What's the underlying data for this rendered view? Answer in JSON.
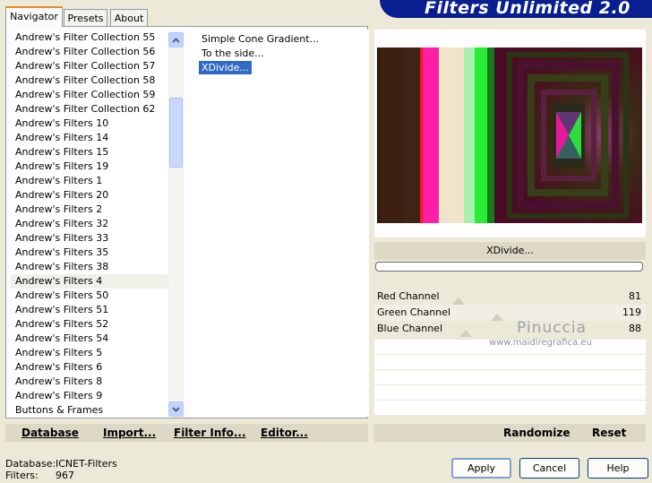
{
  "tabs": [
    {
      "label": "Navigator"
    },
    {
      "label": "Presets"
    },
    {
      "label": "About"
    }
  ],
  "header": {
    "title": "Filters Unlimited 2.0",
    "bg_color": "#0a1f8f"
  },
  "categories": [
    "Andrew's Filter Collection 55",
    "Andrew's Filter Collection 56",
    "Andrew's Filter Collection 57",
    "Andrew's Filter Collection 58",
    "Andrew's Filter Collection 59",
    "Andrew's Filter Collection 62",
    "Andrew's Filters 10",
    "Andrew's Filters 14",
    "Andrew's Filters 15",
    "Andrew's Filters 19",
    "Andrew's Filters 1",
    "Andrew's Filters 20",
    "Andrew's Filters 2",
    "Andrew's Filters 32",
    "Andrew's Filters 33",
    "Andrew's Filters 35",
    "Andrew's Filters 38",
    "Andrew's Filters 4",
    "Andrew's Filters 50",
    "Andrew's Filters 51",
    "Andrew's Filters 52",
    "Andrew's Filters 54",
    "Andrew's Filters 5",
    "Andrew's Filters 6",
    "Andrew's Filters 8",
    "Andrew's Filters 9",
    "Buttons & Frames"
  ],
  "selected_category": "Andrew's Filters 4",
  "filters": [
    {
      "label": "Simple Cone Gradient..."
    },
    {
      "label": "To the side..."
    },
    {
      "label": "XDivide..."
    }
  ],
  "selected_filter": "XDivide...",
  "left_bar": {
    "database": "Database",
    "import": "Import...",
    "filter_info": "Filter Info...",
    "editor": "Editor..."
  },
  "preview": {
    "filter_name": "XDivide..."
  },
  "channels": [
    {
      "label": "Red Channel",
      "value": 81
    },
    {
      "label": "Green Channel",
      "value": 119
    },
    {
      "label": "Blue Channel",
      "value": 88
    }
  ],
  "watermark": {
    "line1": "Pinuccia",
    "line2": "www.maidiregrafica.eu"
  },
  "right_bar": {
    "randomize": "Randomize",
    "reset": "Reset"
  },
  "status": {
    "database_label": "Database:",
    "database_value": "ICNET-Filters",
    "filters_label": "Filters:",
    "filters_value": "967"
  },
  "buttons": {
    "apply": "Apply",
    "cancel": "Cancel",
    "help": "Help"
  },
  "icons": {
    "scroll_up": "chevron-up-icon",
    "scroll_down": "chevron-down-icon"
  }
}
